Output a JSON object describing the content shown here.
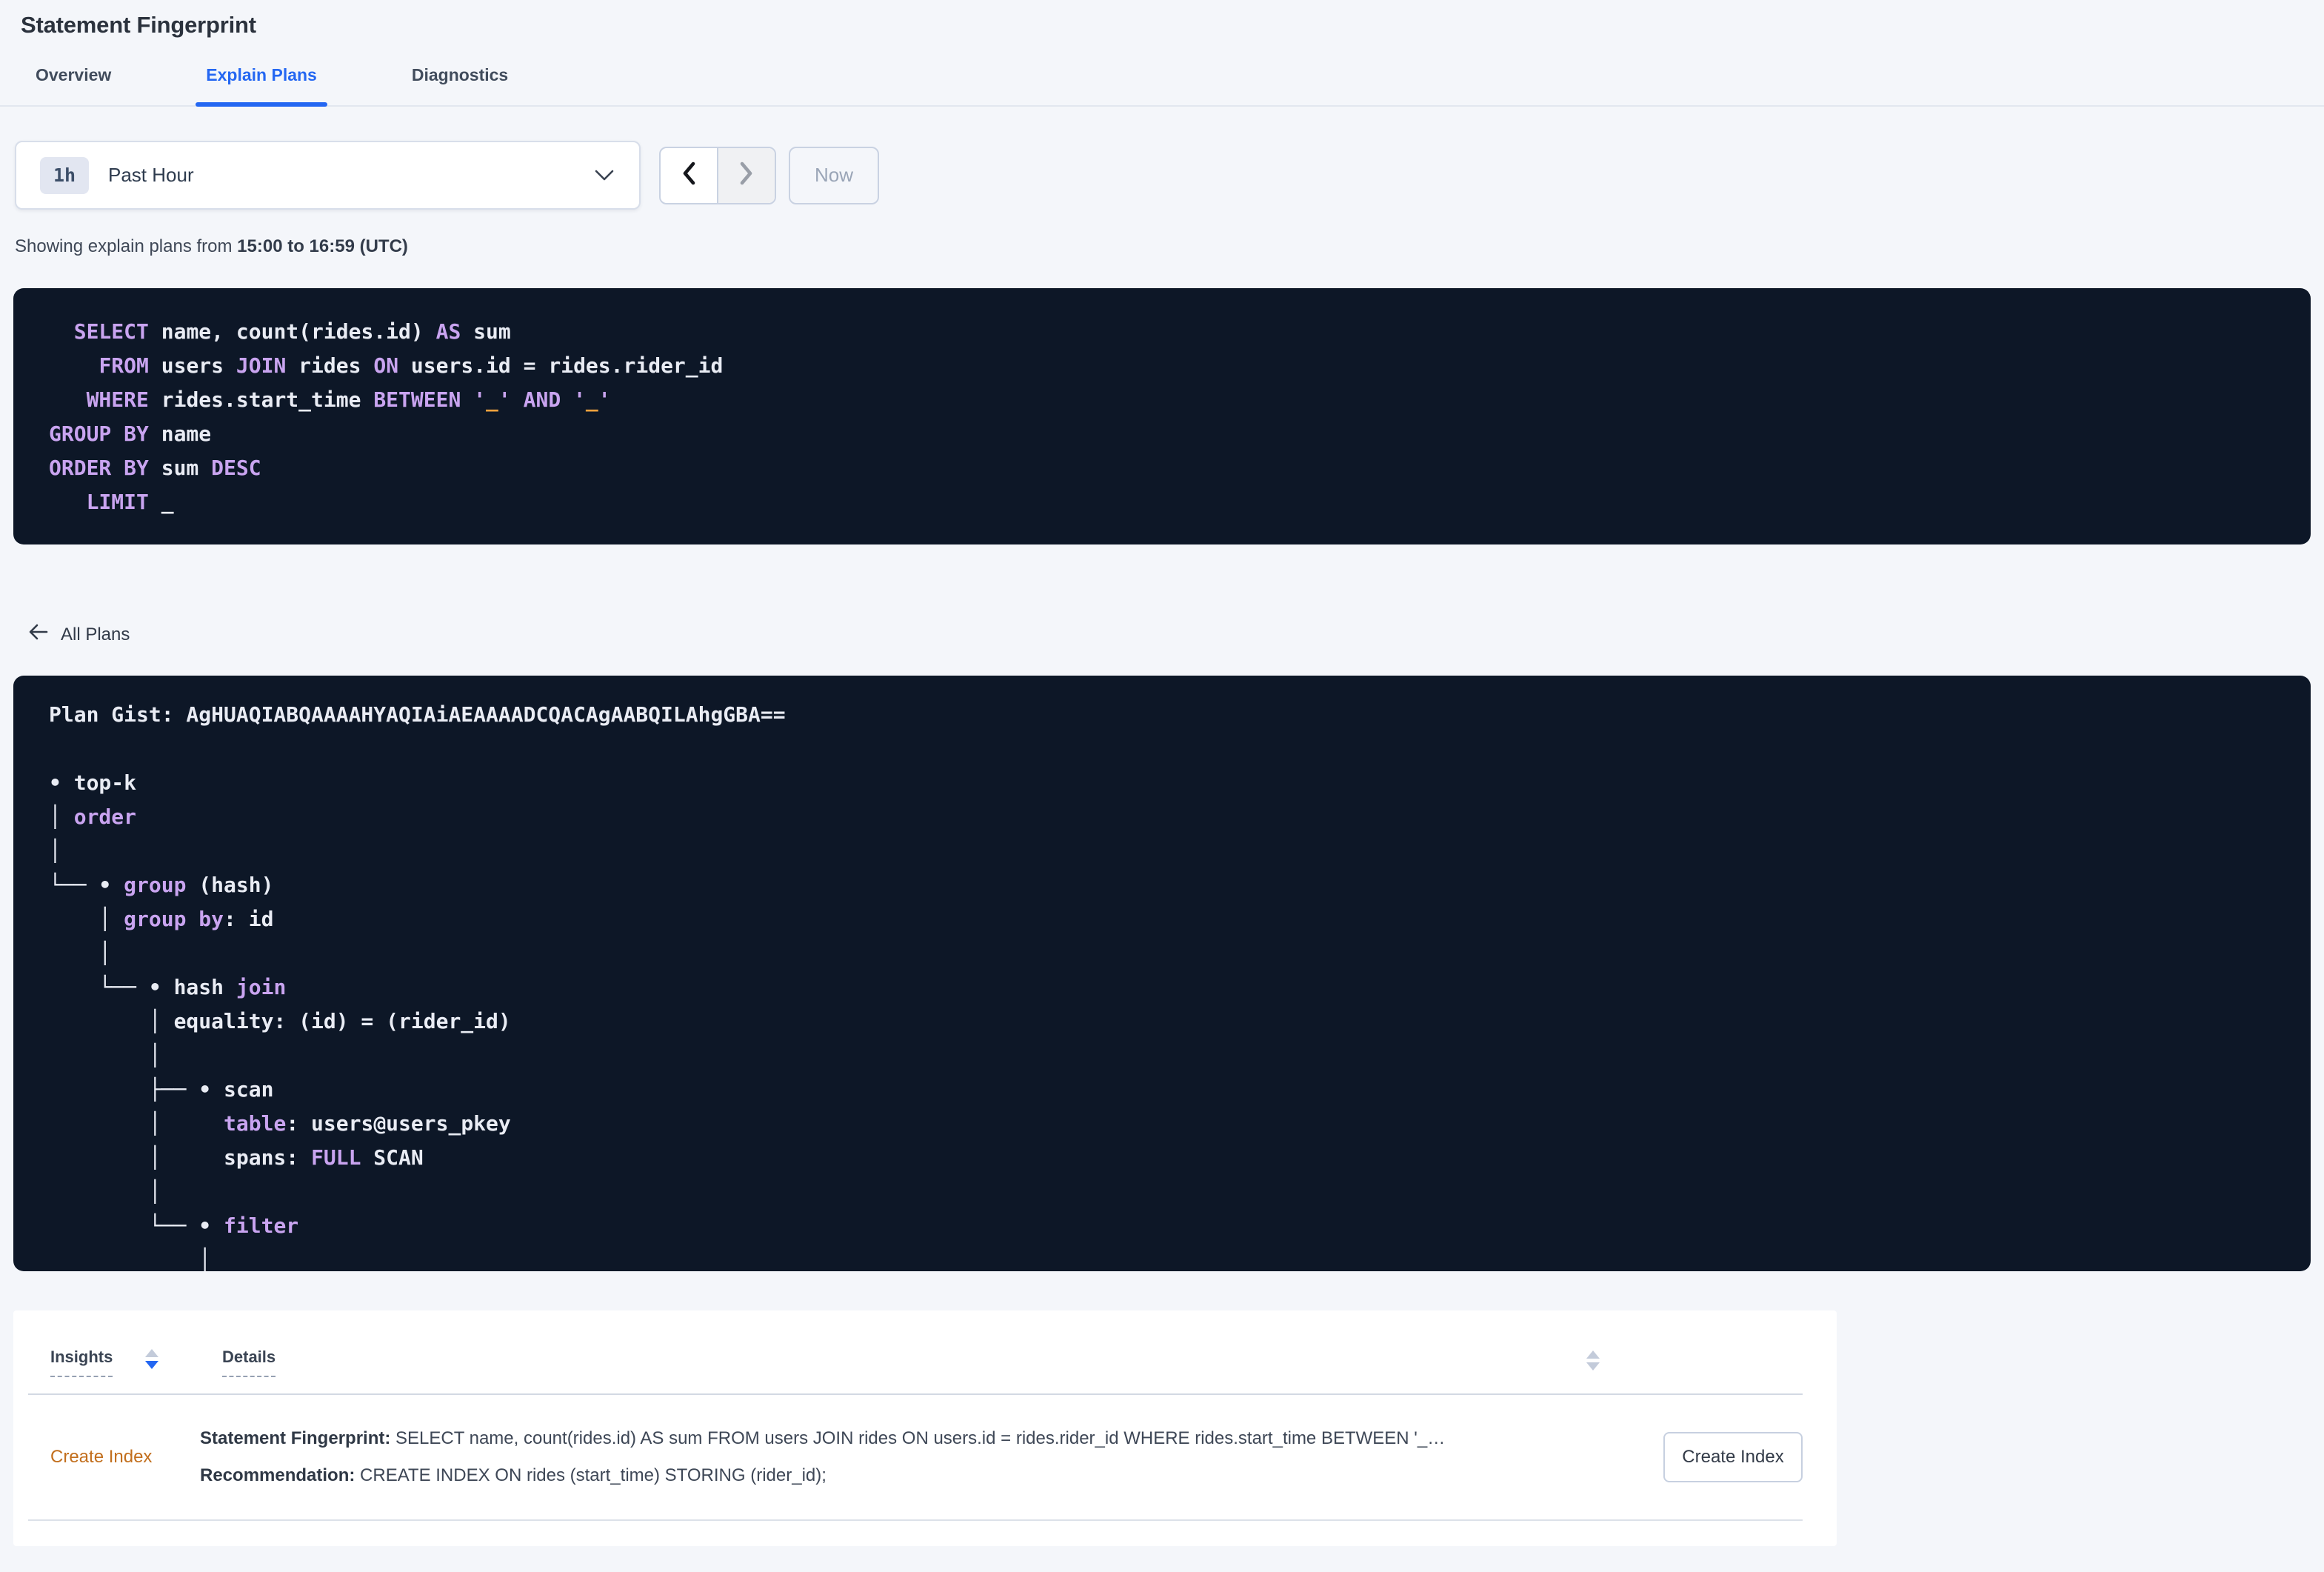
{
  "page_title": "Statement Fingerprint",
  "tabs": {
    "overview": "Overview",
    "explain_plans": "Explain Plans",
    "diagnostics": "Diagnostics"
  },
  "time_controls": {
    "interval_badge": "1h",
    "selected_range": "Past Hour",
    "now_button": "Now"
  },
  "subtitle": {
    "prefix": "Showing explain plans from ",
    "bold_range": "15:00 to 16:59 (UTC)"
  },
  "sql": {
    "lines": [
      [
        {
          "t": "  "
        },
        {
          "t": "SELECT",
          "c": "k"
        },
        {
          "t": " name, count(rides.id) "
        },
        {
          "t": "AS",
          "c": "k"
        },
        {
          "t": " sum"
        }
      ],
      [
        {
          "t": "    "
        },
        {
          "t": "FROM",
          "c": "k"
        },
        {
          "t": " users "
        },
        {
          "t": "JOIN",
          "c": "k"
        },
        {
          "t": " rides "
        },
        {
          "t": "ON",
          "c": "k"
        },
        {
          "t": " users.id = rides.rider_id"
        }
      ],
      [
        {
          "t": "   "
        },
        {
          "t": "WHERE",
          "c": "k"
        },
        {
          "t": " rides.start_time "
        },
        {
          "t": "BETWEEN",
          "c": "k"
        },
        {
          "t": " "
        },
        {
          "t": "'",
          "c": "k"
        },
        {
          "t": "_",
          "c": "l"
        },
        {
          "t": "'",
          "c": "k"
        },
        {
          "t": " "
        },
        {
          "t": "AND",
          "c": "k"
        },
        {
          "t": " "
        },
        {
          "t": "'",
          "c": "k"
        },
        {
          "t": "_",
          "c": "l"
        },
        {
          "t": "'",
          "c": "k"
        }
      ],
      [
        {
          "t": "GROUP BY",
          "c": "k"
        },
        {
          "t": " name"
        }
      ],
      [
        {
          "t": "ORDER BY",
          "c": "k"
        },
        {
          "t": " sum "
        },
        {
          "t": "DESC",
          "c": "k"
        }
      ],
      [
        {
          "t": "   "
        },
        {
          "t": "LIMIT",
          "c": "k"
        },
        {
          "t": " _"
        }
      ]
    ]
  },
  "back_link": {
    "label": "All Plans"
  },
  "plan": {
    "lines": [
      [
        {
          "t": "Plan Gist: AgHUAQIABQAAAAHYAQIAiAEAAAADCQACAgAABQILAhgGBA=="
        }
      ],
      [
        {
          "t": ""
        }
      ],
      [
        {
          "t": "• top-k"
        }
      ],
      [
        {
          "t": "│ "
        },
        {
          "t": "order",
          "c": "k"
        }
      ],
      [
        {
          "t": "│"
        }
      ],
      [
        {
          "t": "└── • "
        },
        {
          "t": "group",
          "c": "k"
        },
        {
          "t": " (hash)"
        }
      ],
      [
        {
          "t": "    │ "
        },
        {
          "t": "group by",
          "c": "k"
        },
        {
          "t": ": id"
        }
      ],
      [
        {
          "t": "    │"
        }
      ],
      [
        {
          "t": "    └── • hash "
        },
        {
          "t": "join",
          "c": "k"
        }
      ],
      [
        {
          "t": "        │ equality: (id) = (rider_id)"
        }
      ],
      [
        {
          "t": "        │"
        }
      ],
      [
        {
          "t": "        ├── • scan"
        }
      ],
      [
        {
          "t": "        │     "
        },
        {
          "t": "table",
          "c": "k"
        },
        {
          "t": ": users@users_pkey"
        }
      ],
      [
        {
          "t": "        │     spans: "
        },
        {
          "t": "FULL",
          "c": "k"
        },
        {
          "t": " SCAN"
        }
      ],
      [
        {
          "t": "        │"
        }
      ],
      [
        {
          "t": "        └── • "
        },
        {
          "t": "filter",
          "c": "k"
        }
      ],
      [
        {
          "t": "            │"
        }
      ]
    ]
  },
  "insights": {
    "columns": {
      "insights": "Insights",
      "details": "Details"
    },
    "row": {
      "insight_type": "Create Index",
      "fingerprint_label": "Statement Fingerprint:",
      "fingerprint_value": " SELECT name, count(rides.id) AS sum FROM users JOIN rides ON users.id = rides.rider_id WHERE rides.start_time BETWEEN '_…",
      "recommendation_label": "Recommendation:",
      "recommendation_value": " CREATE INDEX ON rides (start_time) STORING (rider_id);",
      "action_button": "Create Index"
    }
  },
  "colors": {
    "page_bg": "#f4f6fa",
    "accent_blue": "#2467f2",
    "code_bg": "#0d1727",
    "code_text": "#e9ecf4",
    "code_keyword": "#c9a4f0",
    "code_literal": "#efa23d",
    "insight_orange": "#c26e1c",
    "disabled_text": "#9aa5b7"
  }
}
